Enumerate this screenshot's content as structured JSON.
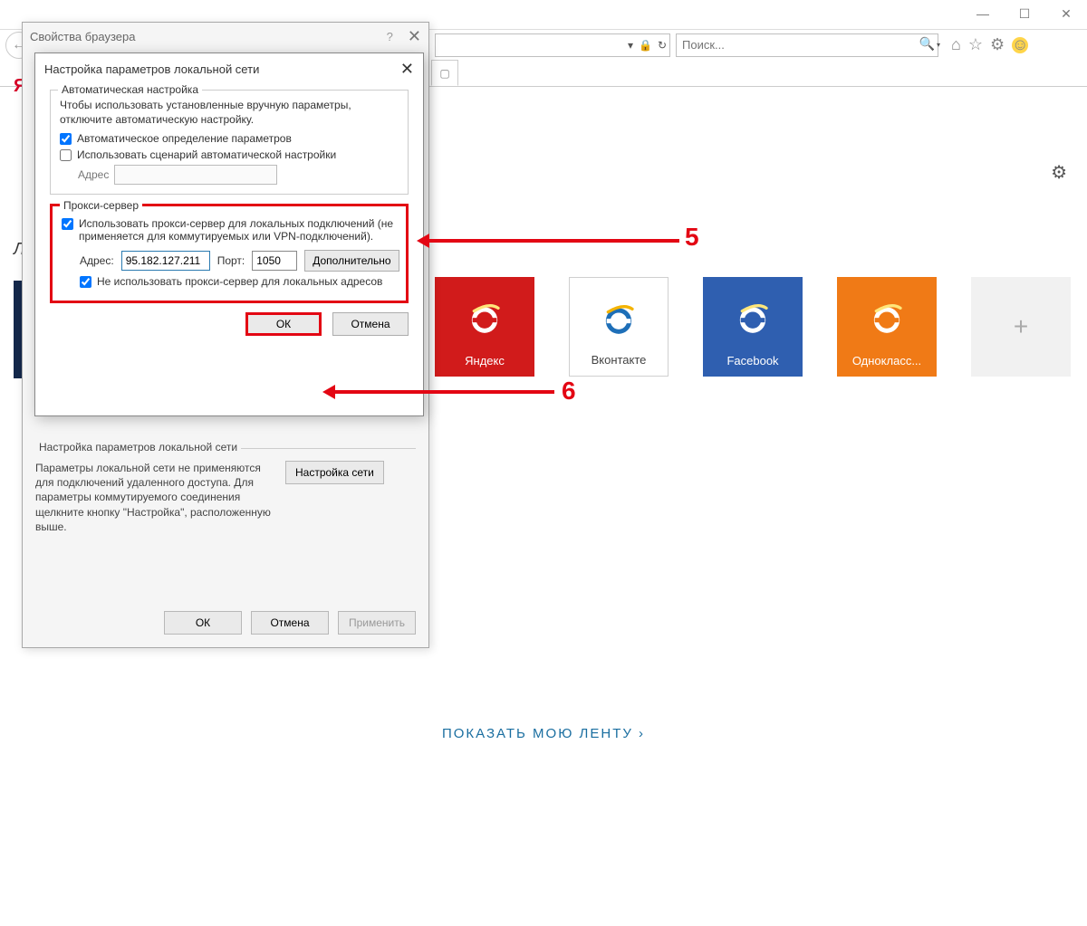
{
  "window": {
    "minimize": "—",
    "maximize": "☐",
    "close": "✕"
  },
  "toolbar": {
    "url_caret": "▾",
    "lock": "🔒",
    "refresh": "↻",
    "search_placeholder": "Поиск...",
    "search_mag": "🔍",
    "home": "⌂",
    "star": "☆",
    "gear": "⚙",
    "smile": "☺"
  },
  "page": {
    "gear": "⚙",
    "feed_link": "ПОКАЗАТЬ МОЮ ЛЕНТУ ›",
    "tiles": [
      {
        "label": "Яндекс",
        "bg": "#d11b1b",
        "fg": "#ffffff"
      },
      {
        "label": "Вконтакте",
        "bg": "#ffffff",
        "fg": "#444444"
      },
      {
        "label": "Facebook",
        "bg": "#2f5fb0",
        "fg": "#ffffff"
      },
      {
        "label": "Однокласс...",
        "bg": "#f07a16",
        "fg": "#ffffff"
      }
    ],
    "add_tile": "+",
    "yandex_letter": "Я",
    "l_letter": "Л"
  },
  "dialog1": {
    "title": "Свойства браузера",
    "help": "?",
    "close": "✕",
    "lan_group_title": "Настройка параметров локальной сети",
    "lan_group_text": "Параметры локальной сети не применяются для подключений удаленного доступа. Для параметры коммутируемого соединения щелкните кнопку \"Настройка\", расположенную выше.",
    "lan_btn": "Настройка сети",
    "ok": "ОК",
    "cancel": "Отмена",
    "apply": "Применить"
  },
  "dialog2": {
    "title": "Настройка параметров локальной сети",
    "close": "✕",
    "auto": {
      "legend": "Автоматическая настройка",
      "desc": "Чтобы использовать установленные вручную параметры, отключите автоматическую настройку.",
      "chk_auto_detect": "Автоматическое определение параметров",
      "chk_auto_detect_checked": true,
      "chk_script": "Использовать сценарий автоматической настройки",
      "chk_script_checked": false,
      "addr_label": "Адрес",
      "addr_value": ""
    },
    "proxy": {
      "legend": "Прокси-сервер",
      "chk_use": "Использовать прокси-сервер для локальных подключений (не применяется для коммутируемых или VPN-подключений).",
      "chk_use_checked": true,
      "addr_label": "Адрес:",
      "addr_value": "95.182.127.211",
      "port_label": "Порт:",
      "port_value": "1050",
      "advanced": "Дополнительно",
      "chk_bypass": "Не использовать прокси-сервер для локальных адресов",
      "chk_bypass_checked": true
    },
    "ok": "ОК",
    "cancel": "Отмена"
  },
  "annotations": {
    "five": "5",
    "six": "6"
  }
}
